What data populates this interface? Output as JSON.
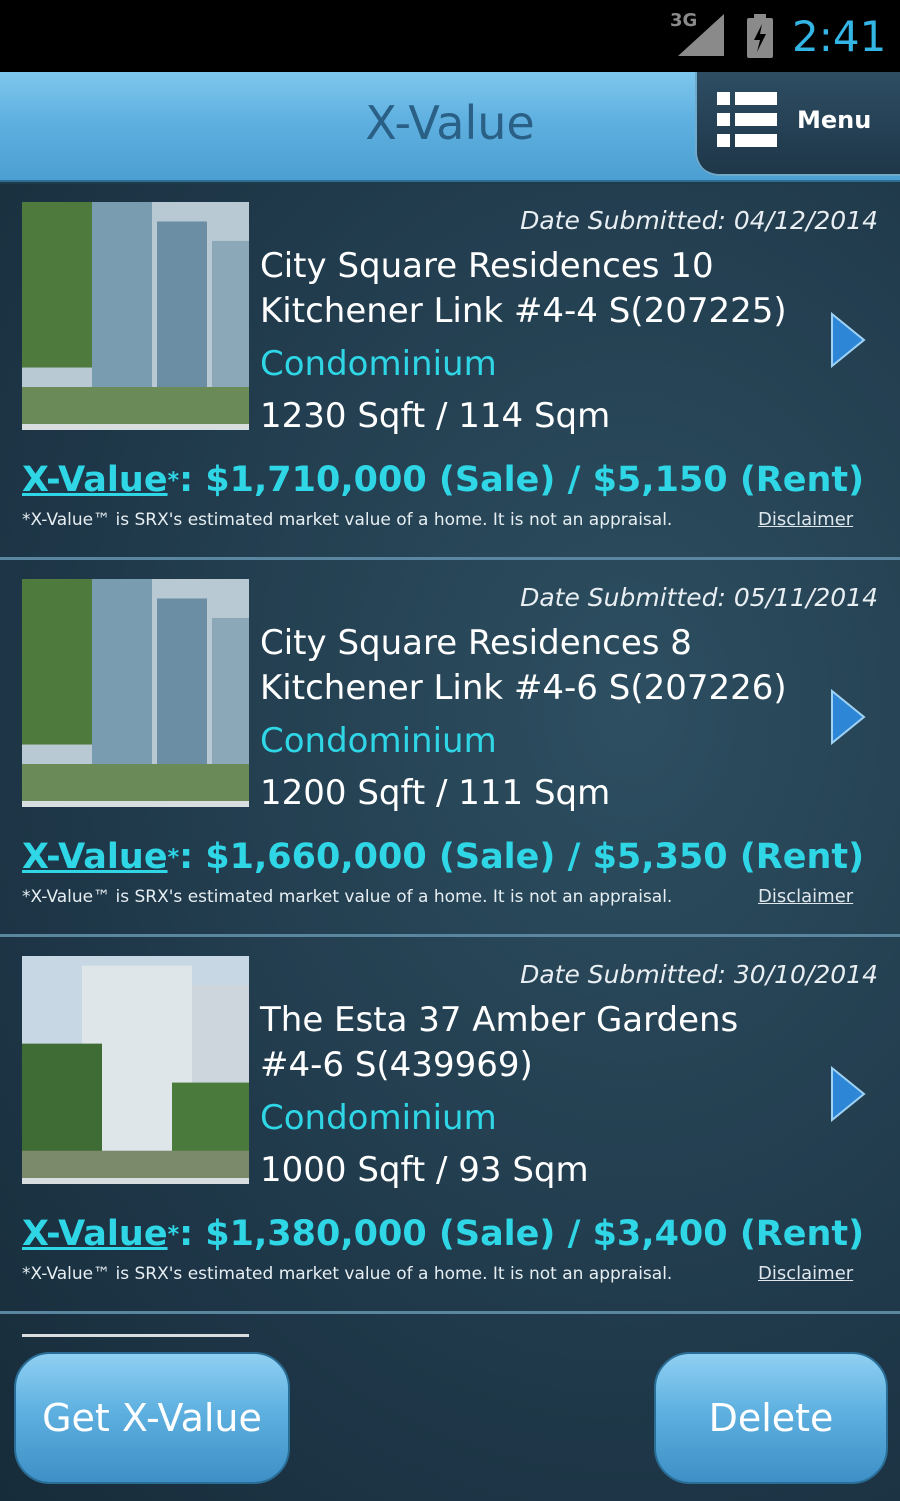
{
  "status_bar": {
    "network": "3G",
    "time": "2:41",
    "icons": [
      "signal-icon",
      "battery-charging-icon"
    ]
  },
  "header": {
    "title": "X-Value",
    "menu_label": "Menu"
  },
  "listings": [
    {
      "date": "Date Submitted: 04/12/2014",
      "address_line1": "City Square Residences 10",
      "address_line2": "Kitchener Link #4-4 S(207225)",
      "type": "Condominium",
      "size": "1230 Sqft / 114 Sqm",
      "xvalue_label": "X-Value",
      "xvalue_amount": ": $1,710,000 (Sale) / $5,150 (Rent)",
      "note": "*X-Value™ is SRX's estimated market value of a home. It is not an appraisal.",
      "disclaimer": "Disclaimer"
    },
    {
      "date": "Date Submitted: 05/11/2014",
      "address_line1": "City Square Residences 8",
      "address_line2": "Kitchener Link #4-6 S(207226)",
      "type": "Condominium",
      "size": "1200 Sqft / 111 Sqm",
      "xvalue_label": "X-Value",
      "xvalue_amount": ": $1,660,000 (Sale) / $5,350 (Rent)",
      "note": "*X-Value™ is SRX's estimated market value of a home. It is not an appraisal.",
      "disclaimer": "Disclaimer"
    },
    {
      "date": "Date Submitted: 30/10/2014",
      "address_line1": "The Esta 37 Amber Gardens",
      "address_line2": "#4-6 S(439969)",
      "type": "Condominium",
      "size": "1000 Sqft / 93 Sqm",
      "xvalue_label": "X-Value",
      "xvalue_amount": ": $1,380,000 (Sale) / $3,400 (Rent)",
      "note": "*X-Value™ is SRX's estimated market value of a home. It is not an appraisal.",
      "disclaimer": "Disclaimer"
    }
  ],
  "buttons": {
    "get_xvalue": "Get X-Value",
    "delete": "Delete"
  },
  "colors": {
    "accent": "#2fd6e6",
    "header": "#5fb0e0",
    "background": "#1f3a4a",
    "clock": "#33b5e5"
  }
}
